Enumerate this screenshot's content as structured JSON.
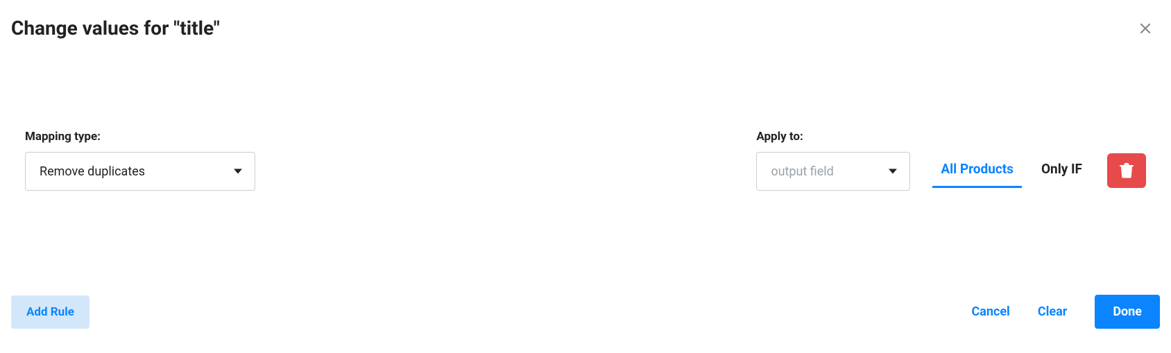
{
  "header": {
    "title": "Change values for \"title\""
  },
  "mapping": {
    "label": "Mapping type:",
    "value": "Remove duplicates"
  },
  "apply_to": {
    "label": "Apply to:",
    "placeholder": "output field"
  },
  "scope": {
    "all_products": "All Products",
    "only_if": "Only IF"
  },
  "footer": {
    "add_rule": "Add Rule",
    "cancel": "Cancel",
    "clear": "Clear",
    "done": "Done"
  }
}
